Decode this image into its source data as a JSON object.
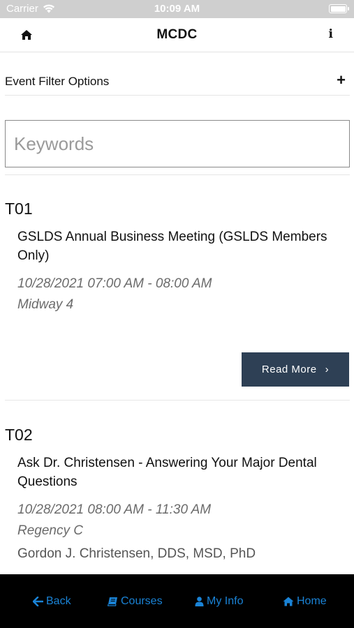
{
  "status_bar": {
    "carrier": "Carrier",
    "time": "10:09 AM"
  },
  "nav": {
    "title": "MCDC",
    "info_glyph": "i"
  },
  "filter": {
    "label": "Event Filter Options",
    "toggle": "+"
  },
  "search": {
    "placeholder": "Keywords",
    "value": ""
  },
  "events": [
    {
      "code": "T01",
      "title": "GSLDS Annual Business Meeting (GSLDS Members Only)",
      "datetime": "10/28/2021 07:00 AM - 08:00 AM",
      "location": "Midway 4",
      "read_more": "Read More"
    },
    {
      "code": "T02",
      "title": "Ask Dr. Christensen - Answering Your Major Dental Questions",
      "datetime": "10/28/2021 08:00 AM - 11:30 AM",
      "location": "Regency C",
      "speaker": "Gordon J. Christensen, DDS, MSD, PhD"
    }
  ],
  "tabs": [
    {
      "label": "Back",
      "icon": "arrow-left-icon"
    },
    {
      "label": "Courses",
      "icon": "book-icon"
    },
    {
      "label": "My Info",
      "icon": "user-icon"
    },
    {
      "label": "Home",
      "icon": "home-icon"
    }
  ],
  "colors": {
    "accent": "#1a83d6",
    "button": "#2e4055",
    "tabbar": "#000000",
    "statusbar": "#cfcfcf"
  }
}
